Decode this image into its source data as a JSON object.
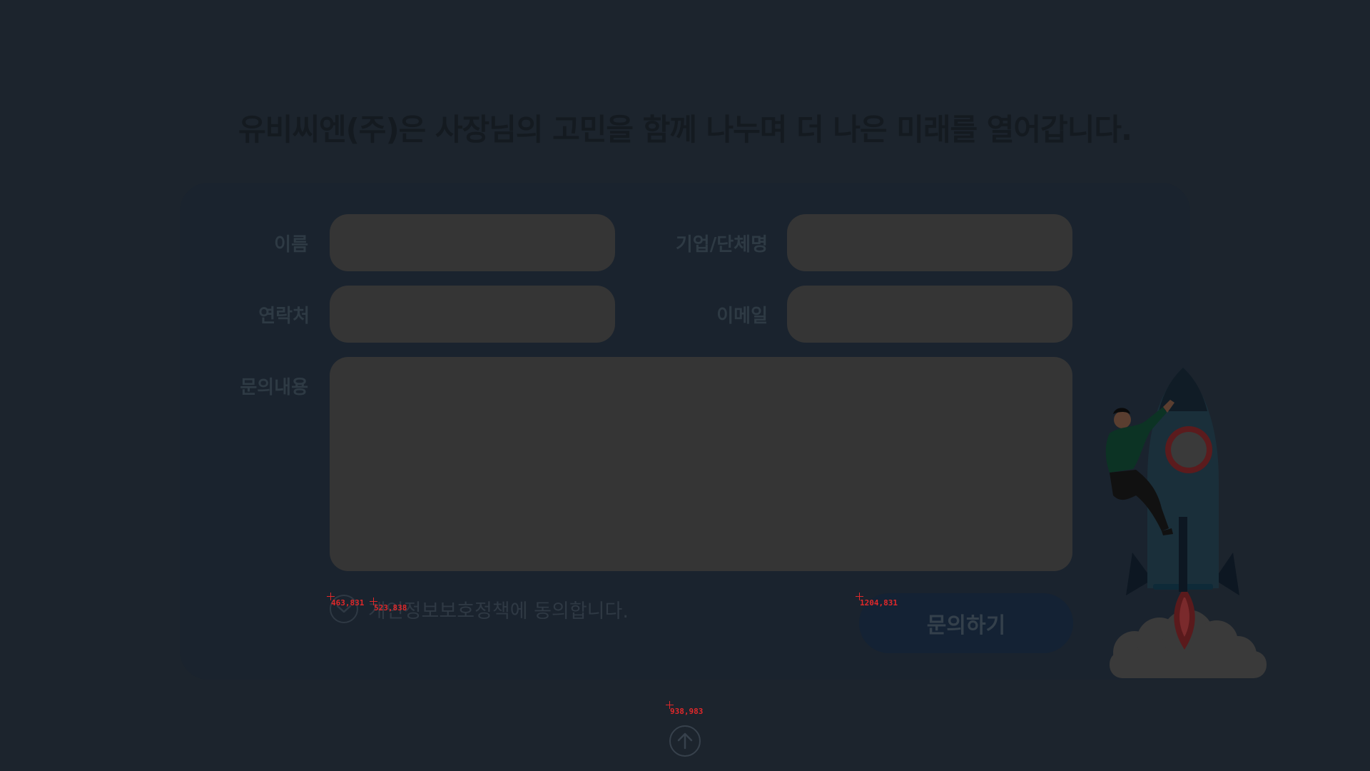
{
  "headline": "유비씨엔(주)은 사장님의 고민을 함께 나누며 더 나은 미래를 열어갑니다.",
  "form": {
    "name_label": "이름",
    "company_label": "기업/단체명",
    "phone_label": "연락처",
    "email_label": "이메일",
    "inquiry_label": "문의내용",
    "name_value": "",
    "company_value": "",
    "phone_value": "",
    "email_value": "",
    "inquiry_value": "",
    "privacy_agree_text": "개인정보보호정책에 동의합니다.",
    "submit_label": "문의하기"
  },
  "debug_markers": [
    "463,831",
    "523,838",
    "1204,831",
    "938,983"
  ],
  "colors": {
    "background": "#1c242d",
    "panel": "#1a232e",
    "input": "#353535",
    "submit": "#142234",
    "marker": "#e0282a"
  },
  "icons": {
    "agree": "check-circle-icon",
    "scroll_top": "arrow-up-circle-icon",
    "illustration": "rocket-person-illustration"
  }
}
